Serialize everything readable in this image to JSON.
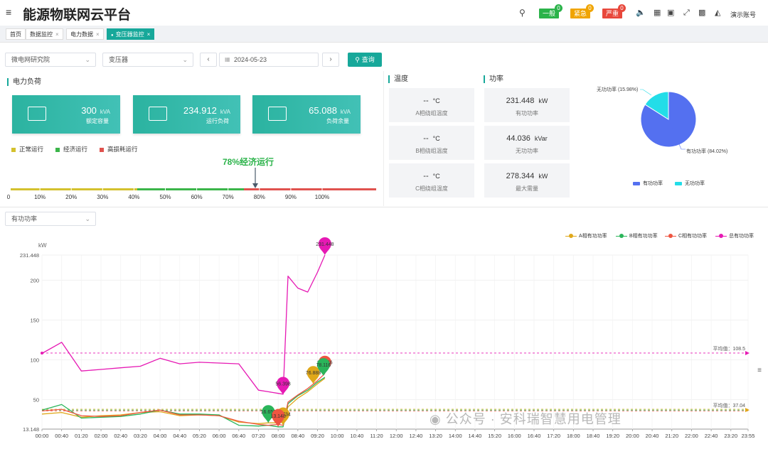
{
  "header": {
    "title": "能源物联网云平台",
    "alarms": [
      {
        "label": "一般",
        "count": "0",
        "color": "#2bb34a"
      },
      {
        "label": "紧急",
        "count": "0",
        "color": "#f0a400"
      },
      {
        "label": "严重",
        "count": "0",
        "color": "#e8473b"
      }
    ],
    "account": "演示账号"
  },
  "tabs": [
    {
      "label": "首页",
      "closable": false,
      "active": false
    },
    {
      "label": "数据监控",
      "closable": true,
      "active": false
    },
    {
      "label": "电力数据",
      "closable": true,
      "active": false
    },
    {
      "label": "变压器监控",
      "closable": true,
      "active": true
    }
  ],
  "filters": {
    "org": "微电网研究院",
    "device": "变压器",
    "date": "2024-05-23",
    "query_label": "查询"
  },
  "load_section": {
    "title": "电力负荷",
    "cards": [
      {
        "value": "300",
        "unit": "kVA",
        "label": "额定容量"
      },
      {
        "value": "234.912",
        "unit": "kVA",
        "label": "运行负荷"
      },
      {
        "value": "65.088",
        "unit": "kVA",
        "label": "负荷余量"
      }
    ],
    "legend": [
      {
        "label": "正常运行",
        "color": "#d4c12e"
      },
      {
        "label": "经济运行",
        "color": "#3bb54a"
      },
      {
        "label": "高损耗运行",
        "color": "#e0524e"
      }
    ],
    "indicator_label": "78%经济运行",
    "indicator_value": 78,
    "scale": [
      "0",
      "10%",
      "20%",
      "30%",
      "40%",
      "50%",
      "60%",
      "70%",
      "80%",
      "90%",
      "100%"
    ]
  },
  "temperature": {
    "title": "温度",
    "items": [
      {
        "value": "--",
        "unit": "°C",
        "label": "A相绕组温度"
      },
      {
        "value": "--",
        "unit": "°C",
        "label": "B相绕组温度"
      },
      {
        "value": "--",
        "unit": "°C",
        "label": "C相绕组温度"
      }
    ]
  },
  "power": {
    "title": "功率",
    "items": [
      {
        "value": "231.448",
        "unit": "kW",
        "label": "有功功率"
      },
      {
        "value": "44.036",
        "unit": "kVar",
        "label": "无功功率"
      },
      {
        "value": "278.344",
        "unit": "kW",
        "label": "最大需量"
      }
    ]
  },
  "pie": {
    "slices": [
      {
        "name": "有功功率",
        "percent": 84.02,
        "color": "#5470f0"
      },
      {
        "name": "无功功率",
        "percent": 15.98,
        "color": "#23dde8"
      }
    ],
    "label_active": "有功功率 (84.02%)",
    "label_reactive": "无功功率 (15.98%)"
  },
  "trend": {
    "metric_select": "有功功率",
    "unit": "kW",
    "y_ticks": [
      "231.448",
      "200",
      "150",
      "100",
      "50",
      "13.148"
    ],
    "x_ticks": [
      "00:00",
      "00:40",
      "01:20",
      "02:00",
      "02:40",
      "03:20",
      "04:00",
      "04:40",
      "05:20",
      "06:00",
      "06:40",
      "07:20",
      "08:00",
      "08:40",
      "09:20",
      "10:00",
      "10:40",
      "11:20",
      "12:00",
      "12:40",
      "13:20",
      "14:00",
      "14:40",
      "15:20",
      "16:00",
      "16:40",
      "17:20",
      "18:00",
      "18:40",
      "19:20",
      "20:00",
      "20:40",
      "21:20",
      "22:00",
      "22:40",
      "23:20",
      "23:55"
    ],
    "legend": [
      {
        "name": "A相有功功率",
        "color": "#e0a81a"
      },
      {
        "name": "B相有功功率",
        "color": "#2ab55a"
      },
      {
        "name": "C相有功功率",
        "color": "#ee5541"
      },
      {
        "name": "总有功功率",
        "color": "#e619b4"
      }
    ],
    "avg_total_label": "平均值：108.5",
    "avg_phase_label": "平均值：37.04",
    "max_label": "231.448",
    "min_total_label": "56.398",
    "min_a_label": "16.656",
    "min_c_label": "16.734",
    "min_b_label": "13.148",
    "end_a_label": "76.888",
    "end_c_label": "82.876",
    "end_b_label": "78.116"
  },
  "chart_data": {
    "type": "line",
    "ylabel": "kW",
    "ylim": [
      13.148,
      231.448
    ],
    "x": [
      "00:00",
      "00:40",
      "01:20",
      "02:00",
      "02:40",
      "03:20",
      "04:00",
      "04:40",
      "05:20",
      "06:00",
      "06:40",
      "07:20",
      "07:40",
      "08:00",
      "08:10",
      "08:20",
      "08:40",
      "09:00",
      "09:20",
      "09:35"
    ],
    "series": [
      {
        "name": "总有功功率",
        "values": [
          108,
          122,
          86,
          88,
          90,
          92,
          102,
          95,
          97,
          96,
          95,
          62,
          60,
          58,
          57,
          205,
          190,
          185,
          210,
          231.448
        ]
      },
      {
        "name": "A相有功功率",
        "values": [
          32,
          34,
          28,
          30,
          31,
          34,
          35,
          30,
          31,
          30,
          22,
          20,
          21,
          21,
          22,
          41,
          52,
          60,
          70,
          76.888
        ]
      },
      {
        "name": "B相有功功率",
        "values": [
          37,
          44,
          27,
          28,
          29,
          32,
          37,
          32,
          32,
          31,
          18,
          17,
          18,
          16,
          16,
          45,
          55,
          62,
          72,
          78.116
        ]
      },
      {
        "name": "C相有功功率",
        "values": [
          36,
          38,
          30,
          29,
          30,
          34,
          37,
          31,
          31,
          30,
          23,
          19,
          18,
          19,
          18,
          47,
          56,
          64,
          74,
          82.876
        ]
      }
    ],
    "avg_lines": [
      {
        "name": "总有功功率",
        "value": 108.5
      },
      {
        "name": "分相",
        "value": 37.04
      }
    ]
  }
}
